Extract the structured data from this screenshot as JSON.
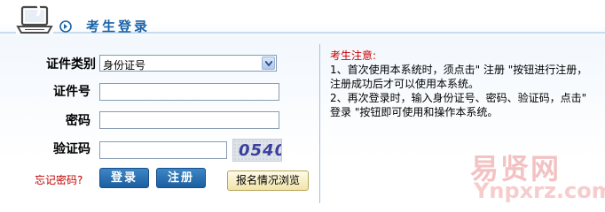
{
  "header": {
    "title": "考生登录"
  },
  "form": {
    "id_type_label": "证件类别",
    "id_type_value": "身份证号",
    "id_number_label": "证件号",
    "password_label": "密码",
    "captcha_label": "验证码",
    "captcha_text": "0540"
  },
  "actions": {
    "forgot_label": "忘记密码?",
    "login_label": "登录",
    "register_label": "注册",
    "status_label": "报名情况浏览"
  },
  "notice": {
    "title": "考生注意:",
    "item1": "1、首次使用本系统时，须点击\" 注册 \"按钮进行注册，注册成功后才可以使用本系统。",
    "item2": "2、再次登录时，输入身份证号、密码、验证码，点击\" 登录 \"按钮即可使用和操作本系统。"
  },
  "watermark": {
    "brand": "易贤网",
    "domain": "Ynpxrz.com"
  },
  "icons": {
    "header_icon": "laptop-icon",
    "title_bullet": "arrow-icon",
    "dropdown": "chevron-down-icon"
  },
  "colors": {
    "accent": "#1a63a8",
    "notice_title": "#cc0000",
    "button_blue": "#1c5e9f"
  }
}
